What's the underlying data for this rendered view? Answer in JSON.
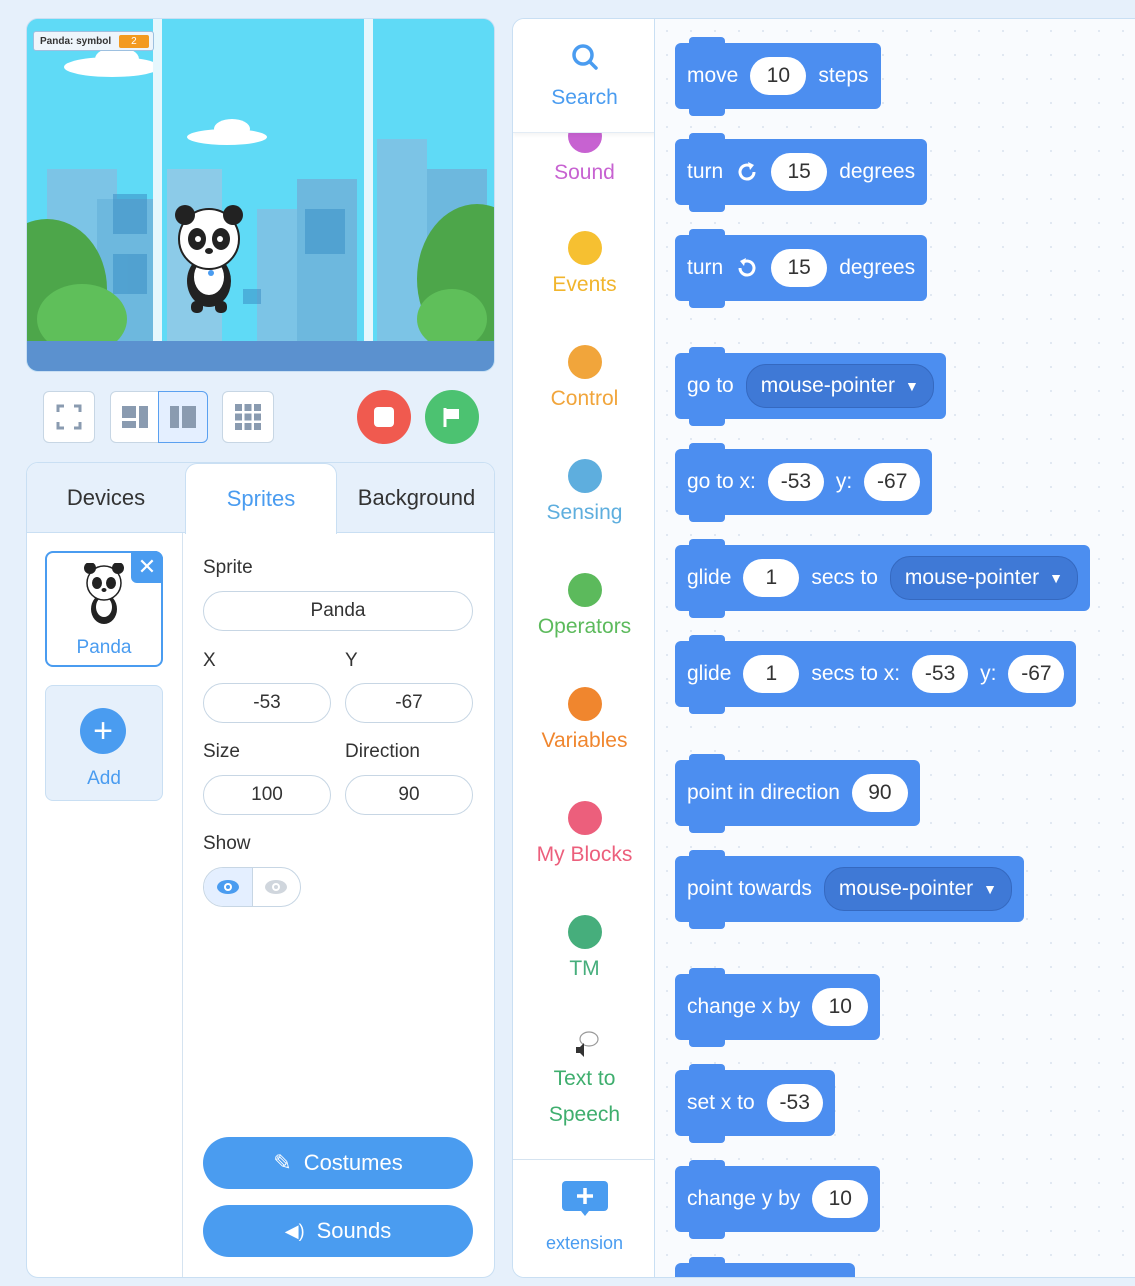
{
  "stage": {
    "variable_monitor": {
      "label": "Panda: symbol",
      "value": "2"
    }
  },
  "toolbar": {
    "fullscreen": "fullscreen-icon",
    "layout_small": "layout-small-icon",
    "layout_normal": "layout-normal-icon",
    "grid": "grid-icon",
    "stop_color": "#f05a4f",
    "go_color": "#4cc271"
  },
  "tabs": {
    "devices": "Devices",
    "sprites": "Sprites",
    "background": "Background"
  },
  "sprite_list": {
    "sprite_name": "Panda",
    "add_label": "Add"
  },
  "properties": {
    "sprite_label": "Sprite",
    "sprite_value": "Panda",
    "x_label": "X",
    "x_value": "-53",
    "y_label": "Y",
    "y_value": "-67",
    "size_label": "Size",
    "size_value": "100",
    "direction_label": "Direction",
    "direction_value": "90",
    "show_label": "Show"
  },
  "buttons": {
    "costumes": "Costumes",
    "sounds": "Sounds"
  },
  "categories": {
    "search": "Search",
    "sound": {
      "label": "Sound",
      "color": "#c762d1"
    },
    "events": {
      "label": "Events",
      "color": "#f6c031"
    },
    "control": {
      "label": "Control",
      "color": "#f1a53b"
    },
    "sensing": {
      "label": "Sensing",
      "color": "#5eaede"
    },
    "operators": {
      "label": "Operators",
      "color": "#5cba5c"
    },
    "variables": {
      "label": "Variables",
      "color": "#f0862e"
    },
    "myblocks": {
      "label": "My Blocks",
      "color": "#ec5f7c"
    },
    "tm": {
      "label": "TM",
      "color": "#46ae7c"
    },
    "tts_line1": "Text to",
    "tts_line2": "Speech",
    "extension": "extension"
  },
  "blocks": {
    "move": {
      "a": "move",
      "n": "10",
      "b": "steps"
    },
    "turn_right": {
      "a": "turn",
      "n": "15",
      "b": "degrees"
    },
    "turn_left": {
      "a": "turn",
      "n": "15",
      "b": "degrees"
    },
    "goto": {
      "a": "go to",
      "d": "mouse-pointer"
    },
    "goto_xy": {
      "a": "go to x:",
      "x": "-53",
      "b": "y:",
      "y": "-67"
    },
    "glide": {
      "a": "glide",
      "n": "1",
      "b": "secs to",
      "d": "mouse-pointer"
    },
    "glide_xy": {
      "a": "glide",
      "n": "1",
      "b": "secs to x:",
      "x": "-53",
      "c": "y:",
      "y": "-67"
    },
    "point_dir": {
      "a": "point in direction",
      "n": "90"
    },
    "point_towards": {
      "a": "point towards",
      "d": "mouse-pointer"
    },
    "change_x": {
      "a": "change x by",
      "n": "10"
    },
    "set_x": {
      "a": "set x to",
      "n": "-53"
    },
    "change_y": {
      "a": "change y by",
      "n": "10"
    }
  }
}
